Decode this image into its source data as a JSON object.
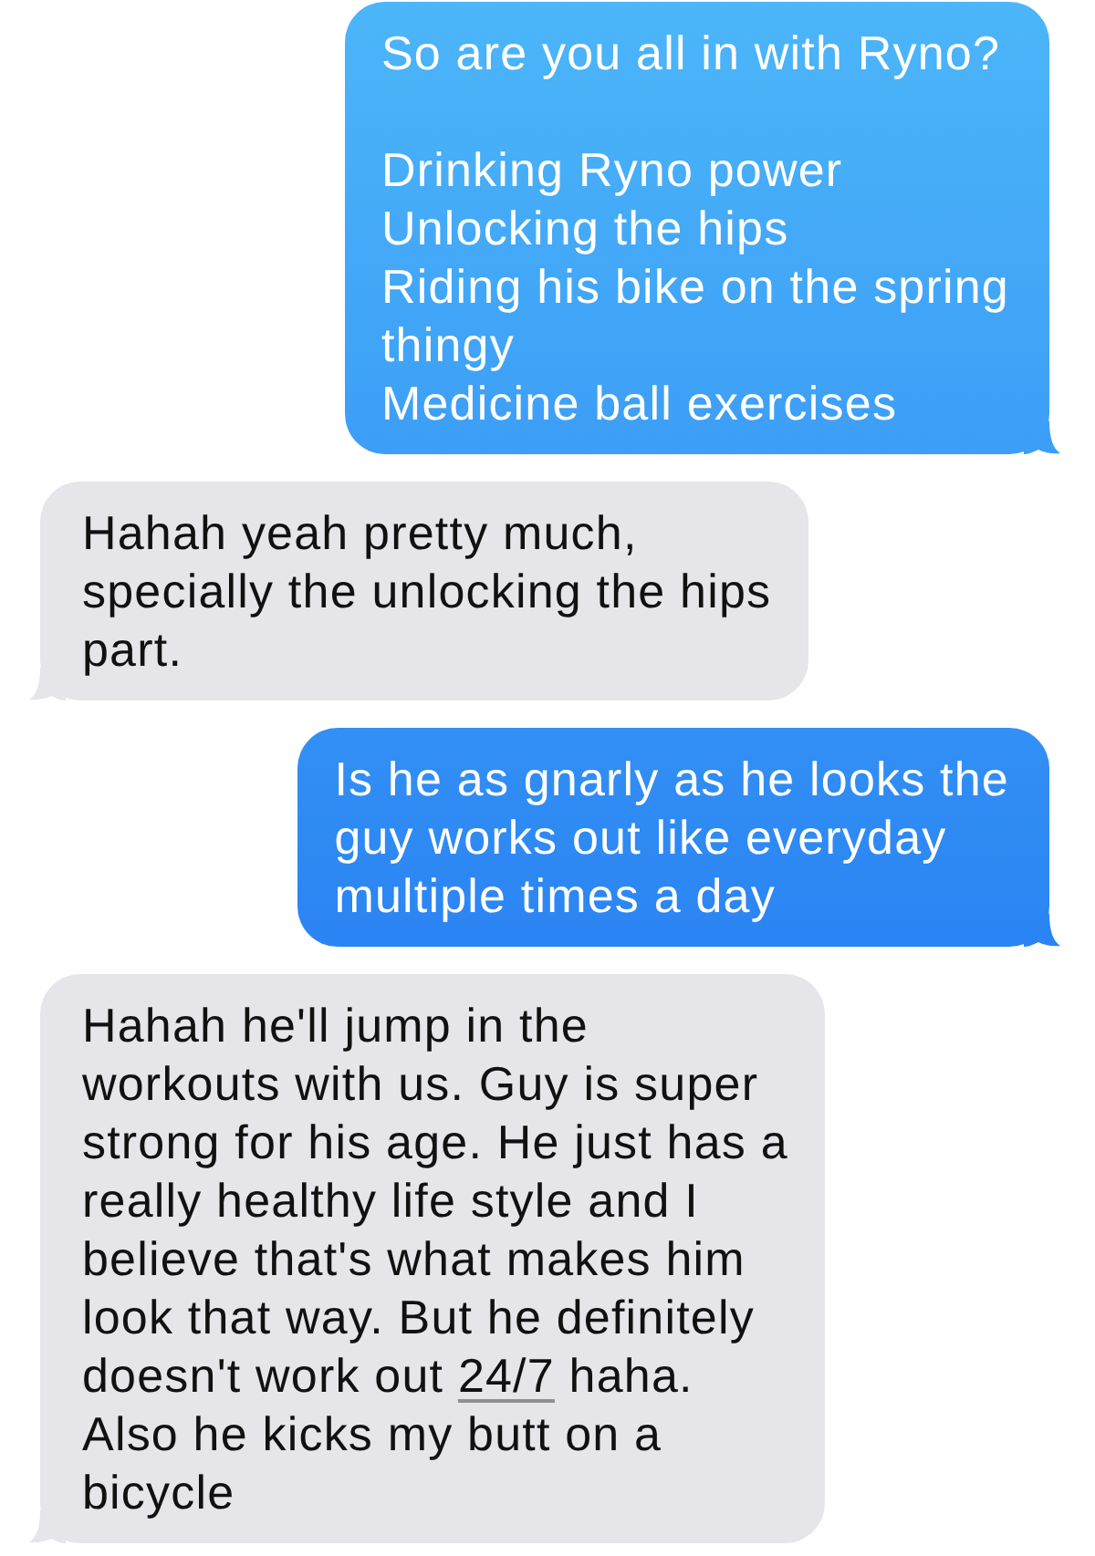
{
  "messages": [
    {
      "kind": "sent",
      "parts": [
        {
          "kind": "text",
          "text": "So are you all in with Ryno?\n\nDrinking Ryno power\nUnlocking the hips\nRiding his bike on the spring\nthingy\nMedicine ball exercises"
        }
      ]
    },
    {
      "kind": "received",
      "parts": [
        {
          "kind": "text",
          "text": "Hahah yeah pretty much,\nspecially the unlocking the hips\npart."
        }
      ]
    },
    {
      "kind": "sent",
      "parts": [
        {
          "kind": "text",
          "text": "Is he as gnarly as he looks the\nguy works out like everyday\nmultiple times a day"
        }
      ]
    },
    {
      "kind": "received",
      "parts": [
        {
          "kind": "text",
          "text": "Hahah he'll jump in the\nworkouts with us. Guy is super\nstrong for his age. He just has a\nreally healthy life style and I\nbelieve that's what makes him\nlook that way. But he definitely\ndoesn't work out "
        },
        {
          "kind": "link",
          "text": "24/7"
        },
        {
          "kind": "text",
          "text": " haha.\nAlso he kicks my butt on a\nbicycle"
        }
      ]
    }
  ]
}
